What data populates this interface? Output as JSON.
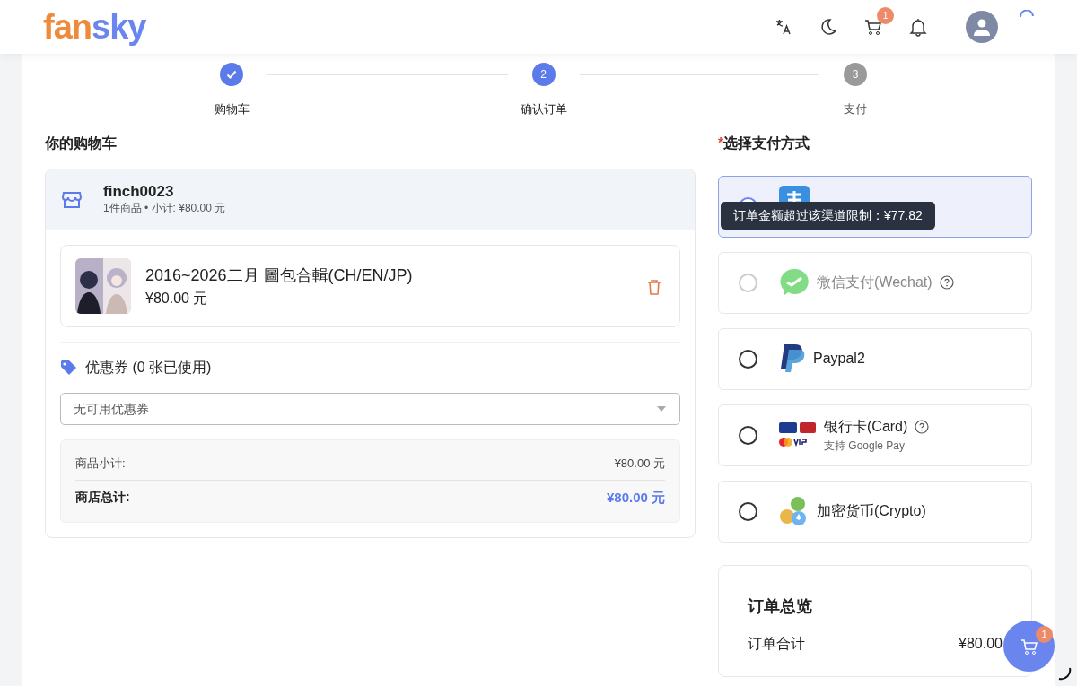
{
  "header": {
    "logo": "fansky",
    "cart_count": "1"
  },
  "steps": [
    {
      "label": "购物车",
      "done": true,
      "active": true
    },
    {
      "label": "确认订单",
      "done": false,
      "active": true,
      "number": "2"
    },
    {
      "label": "支付",
      "done": false,
      "active": false,
      "number": "3"
    }
  ],
  "cart": {
    "title": "你的购物车",
    "store": {
      "name": "finch0023",
      "summary": "1件商品 • 小计: ¥80.00 元"
    },
    "items": [
      {
        "kind": "picture",
        "title": "2016~2026二月 圖包合輯(CH/EN/JP)",
        "price": "¥80.00 元"
      }
    ],
    "coupon": {
      "title": "优惠券 (0 张已使用)",
      "placeholder": "无可用优惠券"
    },
    "totals": [
      {
        "label": "商品小计:",
        "value": "¥80.00 元",
        "kind": "subtotal"
      },
      {
        "label": "商店总计:",
        "value": "¥80.00 元",
        "kind": "total"
      }
    ]
  },
  "payment": {
    "title": "选择支付方式",
    "required_mark": "*",
    "methods": [
      {
        "kind": "alipay",
        "selected": true,
        "disabled": false
      },
      {
        "kind": "wechat",
        "label": "微信支付(Wechat)",
        "selected": false,
        "disabled": true,
        "help": true
      },
      {
        "kind": "paypal",
        "label": "Paypal2",
        "selected": false,
        "disabled": false,
        "help": false
      },
      {
        "kind": "card",
        "label": "银行卡(Card)",
        "note": "支持 Google Pay",
        "selected": false,
        "disabled": false,
        "help": true
      },
      {
        "kind": "crypto",
        "label": "加密货币(Crypto)",
        "selected": false,
        "disabled": false,
        "help": false
      }
    ],
    "tooltip": "订单金额超过该渠道限制：¥77.82"
  },
  "summary": {
    "title": "订单总览",
    "rows": [
      {
        "label": "订单合计",
        "value": "¥80.00"
      }
    ]
  },
  "floating_cart": {
    "count": "1"
  }
}
